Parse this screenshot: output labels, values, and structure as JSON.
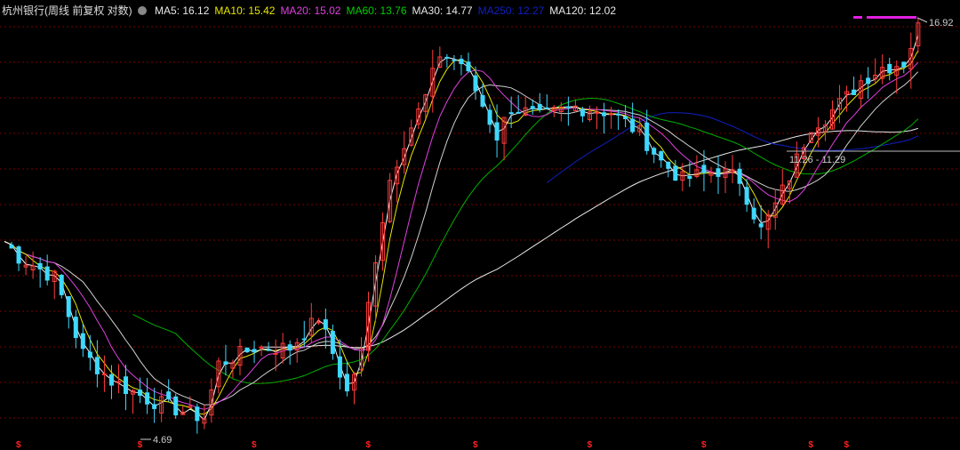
{
  "header": {
    "title": "杭州银行(周线 前复权 对数)",
    "settings_icon": "gear-icon"
  },
  "legend": [
    {
      "label": "MA5: 16.12",
      "color": "#e8e8e8"
    },
    {
      "label": "MA10: 15.42",
      "color": "#e6e600"
    },
    {
      "label": "MA20: 15.02",
      "color": "#e040e0"
    },
    {
      "label": "MA60: 13.76",
      "color": "#00d000"
    },
    {
      "label": "MA30: 14.77",
      "color": "#e8e8e8"
    },
    {
      "label": "MA250: 12.27",
      "color": "#1020c0"
    },
    {
      "label": "MA120: 12.02",
      "color": "#e8e8e8"
    }
  ],
  "chart_data": {
    "type": "candlestick",
    "title": "杭州银行(周线 前复权 对数)",
    "scale": "log",
    "ylim": [
      4.69,
      16.92
    ],
    "high_label": "16.92",
    "low_label": "4.69",
    "gap_label": "11.26 - 11.29",
    "weeks": 128,
    "close_anchors": [
      [
        0,
        8.6
      ],
      [
        2,
        8.2
      ],
      [
        7,
        7.7
      ],
      [
        11,
        6.1
      ],
      [
        15,
        5.6
      ],
      [
        20,
        5.3
      ],
      [
        25,
        5.1
      ],
      [
        28,
        5.0
      ],
      [
        30,
        5.9
      ],
      [
        35,
        6.2
      ],
      [
        40,
        6.2
      ],
      [
        44,
        6.8
      ],
      [
        46,
        6.1
      ],
      [
        48,
        5.4
      ],
      [
        50,
        6.1
      ],
      [
        52,
        8.2
      ],
      [
        54,
        10.4
      ],
      [
        56,
        11.7
      ],
      [
        59,
        13.4
      ],
      [
        61,
        15.3
      ],
      [
        64,
        14.9
      ],
      [
        66,
        13.7
      ],
      [
        69,
        11.9
      ],
      [
        71,
        13.0
      ],
      [
        75,
        12.6
      ],
      [
        80,
        13.0
      ],
      [
        85,
        12.8
      ],
      [
        89,
        12.0
      ],
      [
        92,
        11.0
      ],
      [
        95,
        10.4
      ],
      [
        100,
        10.7
      ],
      [
        103,
        10.4
      ],
      [
        106,
        8.9
      ],
      [
        108,
        9.6
      ],
      [
        110,
        10.5
      ],
      [
        113,
        12.3
      ],
      [
        115,
        12.6
      ],
      [
        118,
        13.4
      ],
      [
        120,
        14.1
      ],
      [
        123,
        14.7
      ],
      [
        126,
        14.9
      ],
      [
        128,
        16.6
      ]
    ],
    "colors": {
      "up": "#ff3b3b",
      "down": "#3fd8ff",
      "grid": "#7a0000",
      "marker": "#ff2020"
    },
    "dividend_markers_weeks": [
      2,
      19,
      35,
      51,
      66,
      82,
      98,
      113,
      118
    ]
  }
}
